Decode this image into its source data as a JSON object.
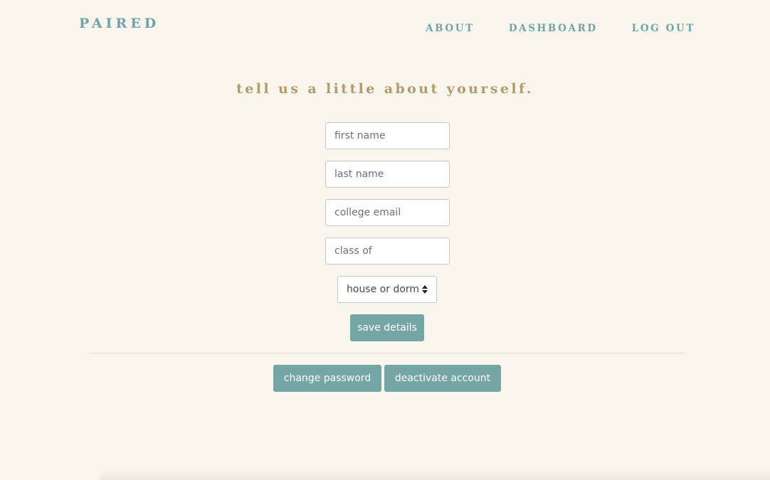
{
  "header": {
    "brand": "PAIRED",
    "nav": {
      "about": "ABOUT",
      "dashboard": "DASHBOARD",
      "logout": "LOG OUT"
    }
  },
  "form": {
    "heading": "tell us a little about yourself.",
    "first_name": {
      "placeholder": "first name",
      "value": ""
    },
    "last_name": {
      "placeholder": "last name",
      "value": ""
    },
    "college_email": {
      "placeholder": "college email",
      "value": ""
    },
    "class_of": {
      "placeholder": "class of",
      "value": ""
    },
    "house_select": {
      "selected": "house or dorm"
    },
    "save_label": "save details"
  },
  "account": {
    "change_password_label": "change password",
    "deactivate_label": "deactivate account"
  },
  "colors": {
    "background": "#f7f5ec",
    "teal": "#6fa5a6",
    "button": "#73a6a5",
    "heading_gold": "#b39c6a"
  }
}
